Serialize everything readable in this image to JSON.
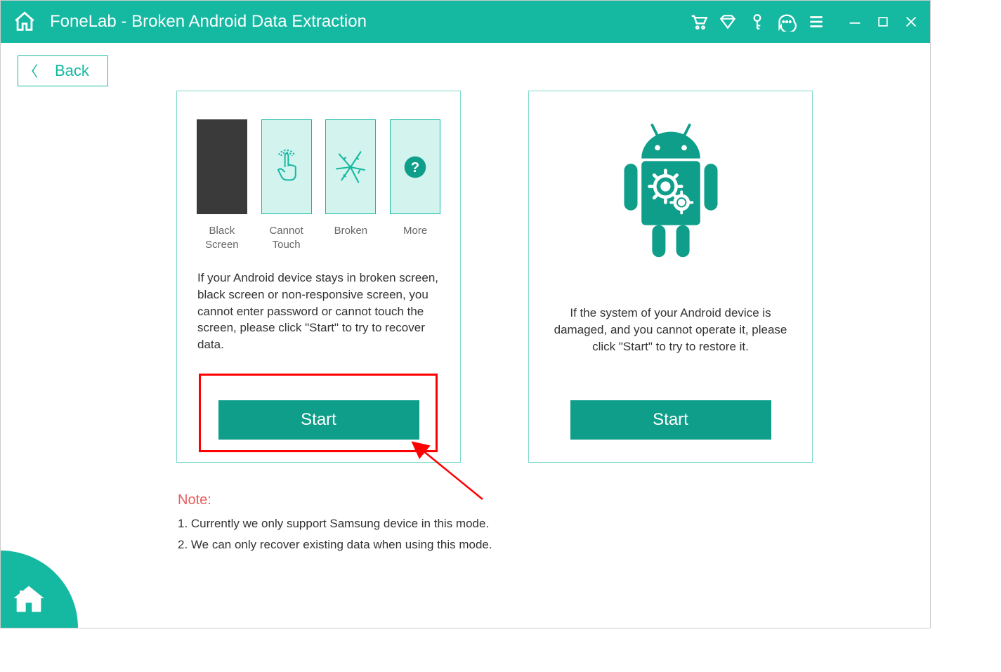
{
  "titlebar": {
    "title": "FoneLab - Broken Android Data Extraction"
  },
  "back_button": {
    "label": "Back"
  },
  "card1": {
    "scenarios": {
      "black_screen": "Black\nScreen",
      "cannot_touch": "Cannot\nTouch",
      "broken": "Broken",
      "more": "More"
    },
    "description": "If your Android device stays in broken screen, black screen or non-responsive screen, you cannot enter password or cannot touch the screen, please click \"Start\" to try to recover data.",
    "start_label": "Start"
  },
  "card2": {
    "description": "If the system of your Android device is damaged, and you cannot operate it, please click \"Start\" to try to restore it.",
    "start_label": "Start"
  },
  "note": {
    "heading": "Note:",
    "line1": "1. Currently we only support Samsung device in this mode.",
    "line2": "2. We can only recover existing data when using this mode."
  }
}
